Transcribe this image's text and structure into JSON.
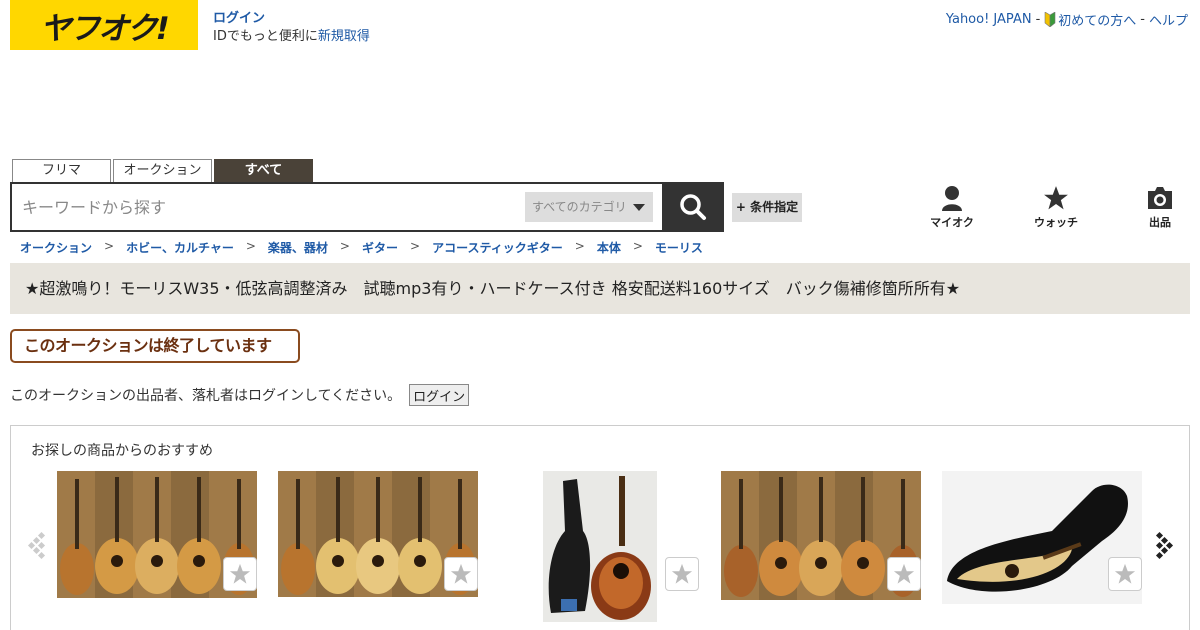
{
  "header": {
    "logo_text": "ヤフオク!",
    "login_label": "ログイン",
    "login_sub_text": "IDでもっと便利に",
    "register_label": "新規取得",
    "nav": {
      "yahoo_label": "Yahoo! JAPAN",
      "beginner_label": "初めての方へ",
      "help_label": "ヘルプ",
      "separator": "-"
    }
  },
  "tabs": [
    {
      "label": "フリマ",
      "active": false
    },
    {
      "label": "オークション",
      "active": false
    },
    {
      "label": "すべて",
      "active": true
    }
  ],
  "search": {
    "placeholder": "キーワードから探す",
    "category_label": "すべてのカテゴリ",
    "advanced_label": "+ 条件指定"
  },
  "quick_icons": [
    {
      "label": "マイオク",
      "icon": "person-icon"
    },
    {
      "label": "ウォッチ",
      "icon": "star-icon"
    },
    {
      "label": "出品",
      "icon": "camera-icon"
    }
  ],
  "breadcrumb": [
    "オークション",
    "ホビー、カルチャー",
    "楽器、器材",
    "ギター",
    "アコースティックギター",
    "本体",
    "モーリス"
  ],
  "breadcrumb_separator": ">",
  "item_title": "★超激鳴り！モーリスW35・低弦高調整済み　試聴mp3有り・ハードケース付き 格安配送料160サイズ　バック傷補修箇所所有★",
  "ended_notice": "このオークションは終了しています",
  "login_note": {
    "text": "このオークションの出品者、落札者はログインしてください。",
    "button_label": "ログイン"
  },
  "recommend": {
    "heading": "お探しの商品からのおすすめ",
    "items": [
      {
        "image": "guitar-set-photo"
      },
      {
        "image": "guitar-set-photo"
      },
      {
        "image": "guitar-with-gigbag-photo"
      },
      {
        "image": "guitar-set-photo"
      },
      {
        "image": "guitar-in-case-photo"
      }
    ]
  },
  "colors": {
    "brand_yellow": "#ffd700",
    "link_blue": "#1f5aa6",
    "dark": "#333333",
    "title_bg": "#e8e5de",
    "ended_border": "#8a4b1f"
  }
}
